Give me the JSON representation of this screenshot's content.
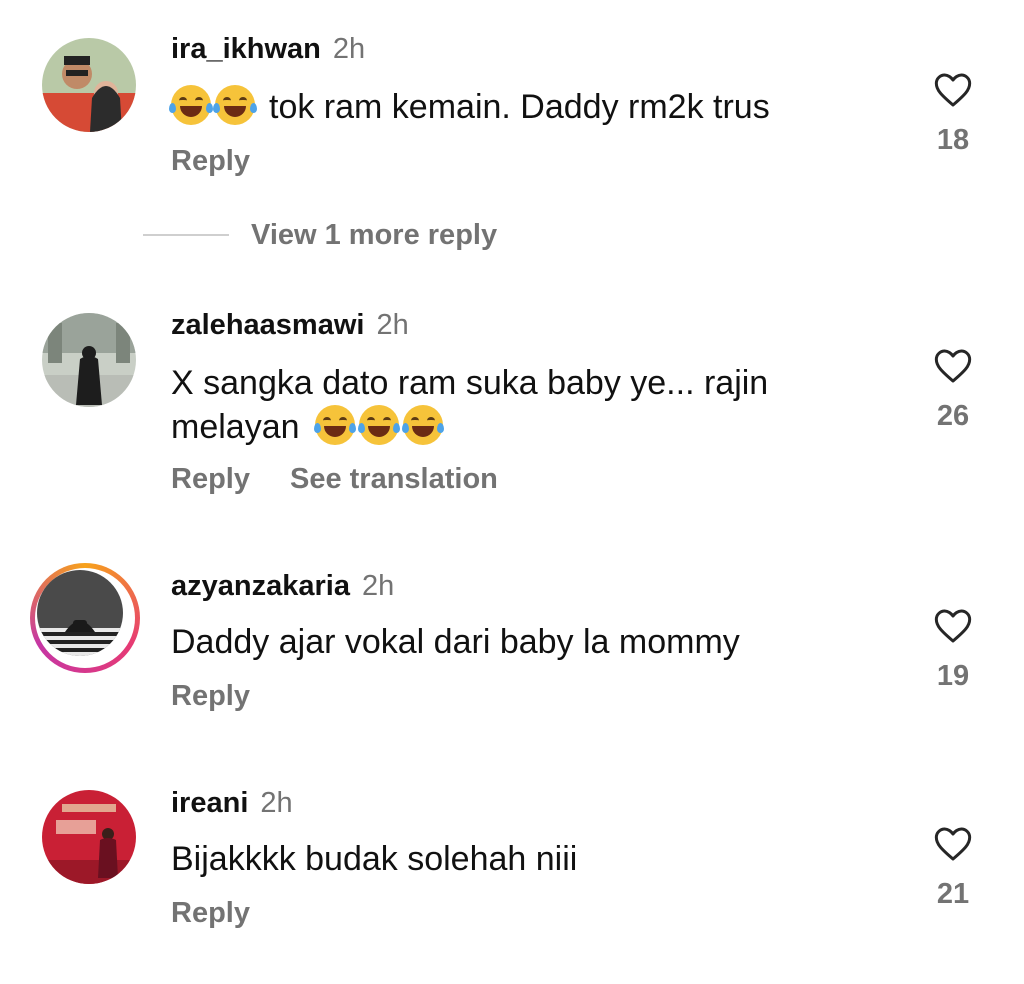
{
  "comments": [
    {
      "username": "ira_ikhwan",
      "time": "2h",
      "emoji_prefix": "🤣🤣",
      "text": "tok ram kemain. Daddy rm2k trus",
      "reply_label": "Reply",
      "likes": "18",
      "view_more": "View 1 more reply"
    },
    {
      "username": "zalehaasmawi",
      "time": "2h",
      "text_line1": "X sangka dato ram suka baby ye... rajin",
      "text_line2": "melayan",
      "emoji_suffix": "😂😂😂",
      "reply_label": "Reply",
      "translate_label": "See translation",
      "likes": "26"
    },
    {
      "username": "azyanzakaria",
      "time": "2h",
      "text": "Daddy ajar vokal dari baby la mommy",
      "reply_label": "Reply",
      "likes": "19"
    },
    {
      "username": "ireani",
      "time": "2h",
      "text": "Bijakkkk budak solehah niii",
      "reply_label": "Reply",
      "likes": "21"
    }
  ],
  "icons": {
    "like": "heart-outline-icon"
  },
  "colors": {
    "secondary_text": "#737373",
    "primary_text": "#111111",
    "story_ring": "#e63a74"
  }
}
